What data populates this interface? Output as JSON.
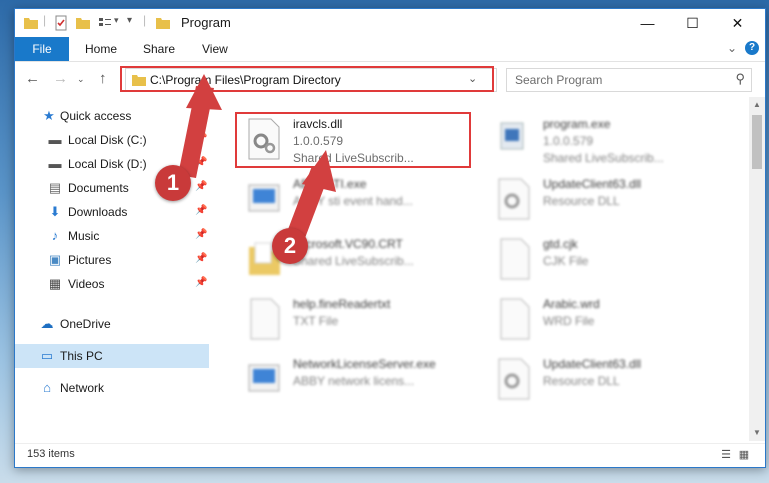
{
  "window": {
    "title": "Program"
  },
  "controls": {
    "minimize": "—",
    "maximize": "☐",
    "close": "✕"
  },
  "ribbon": {
    "tabs": [
      "File",
      "Home",
      "Share",
      "View"
    ],
    "expand_icon": "chevron-down-icon",
    "help_icon": "help-icon",
    "accent": "#1979ca"
  },
  "address": {
    "path": "C:\\Program Files\\Program Directory",
    "chevron": "⌄",
    "refresh": "↻"
  },
  "search": {
    "placeholder": "Search Program",
    "icon": "⚲"
  },
  "sidebar": {
    "items": [
      {
        "label": "Quick access",
        "icon": "star-icon",
        "pinned": false
      },
      {
        "label": "Local Disk (C:)",
        "icon": "drive-icon",
        "pinned": true
      },
      {
        "label": "Local Disk (D:)",
        "icon": "drive-icon",
        "pinned": true
      },
      {
        "label": "Documents",
        "icon": "documents-icon",
        "pinned": true
      },
      {
        "label": "Downloads",
        "icon": "download-icon",
        "pinned": true
      },
      {
        "label": "Music",
        "icon": "music-icon",
        "pinned": true
      },
      {
        "label": "Pictures",
        "icon": "pictures-icon",
        "pinned": true
      },
      {
        "label": "Videos",
        "icon": "videos-icon",
        "pinned": true
      },
      {
        "label": "OneDrive",
        "icon": "cloud-icon",
        "pinned": false
      },
      {
        "label": "This PC",
        "icon": "pc-icon",
        "pinned": false,
        "selected": true
      },
      {
        "label": "Network",
        "icon": "network-icon",
        "pinned": false
      }
    ]
  },
  "files": [
    {
      "name": "iravcls.dll",
      "line2": "1.0.0.579",
      "line3": "Shared LiveSubscrib...",
      "highlighted": true
    },
    {
      "name": "program.exe",
      "line2": "1.0.0.579",
      "line3": "Shared LiveSubscrib..."
    },
    {
      "name": "ABBYSTI.exe",
      "line2": "ABBY sti event hand...",
      "line3": ""
    },
    {
      "name": "UpdateClient63.dll",
      "line2": "Resource DLL",
      "line3": ""
    },
    {
      "name": "Microsoft.VC90.CRT",
      "line2": "",
      "line3": ""
    },
    {
      "name": "gtd.cjk",
      "line2": "CJK File",
      "line3": ""
    },
    {
      "name": "",
      "line2": "Shared LiveSubscrib...",
      "line3": ""
    },
    {
      "name": "help.fineReadertxt",
      "line2": "TXT File",
      "line3": ""
    },
    {
      "name": "Arabic.wrd",
      "line2": "WRD File",
      "line3": ""
    },
    {
      "name": "NetworkLicenseServer.exe",
      "line2": "ABBY network licens...",
      "line3": ""
    },
    {
      "name": "UpdateClient63.dll",
      "line2": "Resource DLL",
      "line3": ""
    }
  ],
  "status": {
    "count": "153 items"
  },
  "annotations": {
    "badge1": "1",
    "badge2": "2",
    "color": "#c93a3a"
  }
}
